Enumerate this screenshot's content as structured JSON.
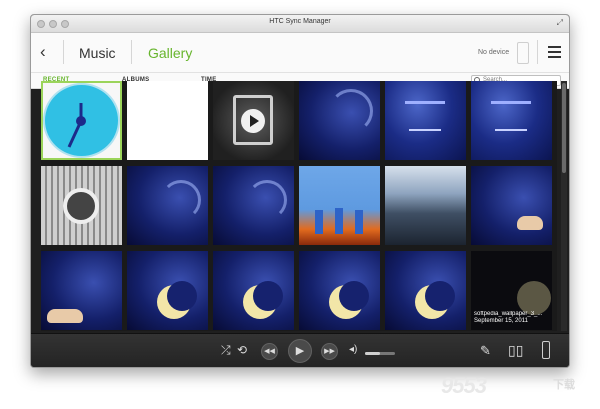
{
  "window": {
    "title": "HTC Sync Manager"
  },
  "header": {
    "back_icon": "chevron-left-icon",
    "tabs": [
      {
        "label": "Music"
      },
      {
        "label": "Gallery"
      }
    ],
    "active_tab": "Gallery",
    "device_status": "No device",
    "menu_icon": "hamburger-menu-icon"
  },
  "subnav": {
    "tabs": [
      {
        "label": "RECENT"
      },
      {
        "label": "ALBUMS"
      },
      {
        "label": "TIME"
      }
    ],
    "active": "RECENT",
    "search_placeholder": "Search..."
  },
  "gallery": {
    "thumbnails": [
      {
        "kind": "clock"
      },
      {
        "kind": "white"
      },
      {
        "kind": "video"
      },
      {
        "kind": "blue-swirl"
      },
      {
        "kind": "softpedia-text"
      },
      {
        "kind": "softpedia-text"
      },
      {
        "kind": "test-pattern"
      },
      {
        "kind": "blue-swirl"
      },
      {
        "kind": "blue-swirl"
      },
      {
        "kind": "softpedia-bright"
      },
      {
        "kind": "sea"
      },
      {
        "kind": "wallpaper-figure"
      },
      {
        "kind": "wallpaper-figure"
      },
      {
        "kind": "moon"
      },
      {
        "kind": "moon"
      },
      {
        "kind": "moon"
      },
      {
        "kind": "moon"
      },
      {
        "kind": "selected-caption"
      }
    ],
    "caption": {
      "title": "softpedia_wallpaper_3_...",
      "date": "September 15, 2011"
    }
  },
  "player": {
    "shuffle_icon": "shuffle-icon",
    "repeat_icon": "repeat-icon",
    "rewind_icon": "rewind-icon",
    "play_icon": "play-icon",
    "forward_icon": "fast-forward-icon",
    "volume_icon": "volume-icon",
    "volume_level": 0.5,
    "edit_icon": "edit-icon",
    "library_icon": "book-icon",
    "phone_icon": "phone-icon"
  },
  "watermark": {
    "text": "9553",
    "suffix": "下载"
  },
  "colors": {
    "accent": "#67b52d",
    "window_bg": "#1f1f1f",
    "header_bg": "#fafafa"
  }
}
